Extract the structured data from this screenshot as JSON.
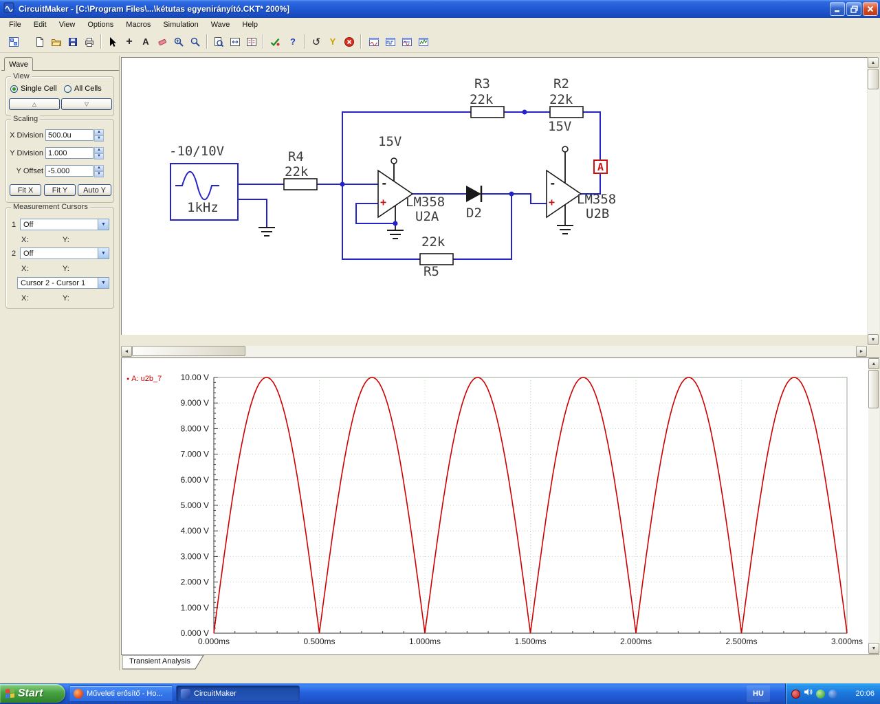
{
  "window": {
    "title": "CircuitMaker - [C:\\Program Files\\...\\kétutas egyenirányító.CKT* 200%]"
  },
  "menu": {
    "items": [
      "File",
      "Edit",
      "View",
      "Options",
      "Macros",
      "Simulation",
      "Wave",
      "Help"
    ]
  },
  "toolbar": {
    "glyph_plus": "+",
    "glyph_text": "A",
    "glyph_help": "?",
    "glyph_reset": "↺",
    "glyph_probe": "Y"
  },
  "icons": {
    "spinner_up": "▲",
    "spinner_down": "▼",
    "scroll_up": "▲",
    "scroll_down": "▼",
    "scroll_left": "◄",
    "scroll_right": "►",
    "combo_arrow": "▼",
    "triangle_up": "△",
    "triangle_down": "▽",
    "bullet": "●"
  },
  "wave_panel": {
    "tab_label": "Wave",
    "view": {
      "legend": "View",
      "single_cell": "Single Cell",
      "all_cells": "All Cells"
    },
    "scaling": {
      "legend": "Scaling",
      "x_division_label": "X Division",
      "x_division_value": "500.0u",
      "y_division_label": "Y Division",
      "y_division_value": "1.000",
      "y_offset_label": "Y Offset",
      "y_offset_value": "-5.000",
      "fit_x": "Fit X",
      "fit_y": "Fit Y",
      "auto_y": "Auto Y"
    },
    "cursors": {
      "legend": "Measurement Cursors",
      "cursor1_label": "1",
      "cursor1_value": "Off",
      "cursor2_label": "2",
      "cursor2_value": "Off",
      "diff_value": "Cursor 2 - Cursor 1",
      "x_label": "X:",
      "y_label": "Y:"
    }
  },
  "circuit": {
    "source_voltage": "-10/10V",
    "source_frequency": "1kHz",
    "r4_name": "R4",
    "r4_value": "22k",
    "r3_name": "R3",
    "r3_value": "22k",
    "r2_name": "R2",
    "r2_value": "22k",
    "r5_name": "R5",
    "r5_value": "22k",
    "d2_name": "D2",
    "u2a_part": "LM358",
    "u2a_ref": "U2A",
    "u2b_part": "LM358",
    "u2b_ref": "U2B",
    "u2a_supply": "15V",
    "u2b_supply": "15V",
    "probe_label": "A",
    "opamp_minus": "-",
    "opamp_plus": "+"
  },
  "wave_view": {
    "trace_label": "A: u2b_7",
    "tab_label": "Transient Analysis"
  },
  "chart_data": {
    "type": "line",
    "title": "Transient Analysis",
    "series": [
      {
        "name": "A: u2b_7",
        "signal": "full-wave rectified sine",
        "amplitude_v": 10,
        "frequency_hz": 1000,
        "color": "#cc0000"
      }
    ],
    "xlim": [
      0,
      3
    ],
    "ylim": [
      0,
      10
    ],
    "x_unit": "ms",
    "y_unit": "V",
    "x_ticks": [
      "0.000ms",
      "0.500ms",
      "1.000ms",
      "1.500ms",
      "2.000ms",
      "2.500ms",
      "3.000ms"
    ],
    "y_ticks": [
      "10.00 V",
      "9.000 V",
      "8.000 V",
      "7.000 V",
      "6.000 V",
      "5.000 V",
      "4.000 V",
      "3.000 V",
      "2.000 V",
      "1.000 V",
      "0.000 V"
    ],
    "grid": true,
    "peak_values_v": [
      10,
      10,
      10,
      10,
      10,
      10
    ],
    "valley_value_v": 0
  },
  "taskbar": {
    "start_label": "Start",
    "tasks": [
      {
        "label": "Műveleti erősítő - Ho..."
      },
      {
        "label": "CircuitMaker"
      }
    ],
    "language": "HU",
    "clock": "20:06"
  }
}
